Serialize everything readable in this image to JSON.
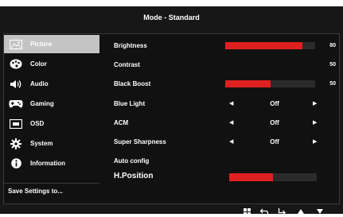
{
  "header": {
    "title": "Mode - Standard"
  },
  "sidebar": {
    "items": [
      {
        "label": "Picture",
        "icon": "picture-icon",
        "active": true
      },
      {
        "label": "Color",
        "icon": "palette-icon",
        "active": false
      },
      {
        "label": "Audio",
        "icon": "speaker-icon",
        "active": false
      },
      {
        "label": "Gaming",
        "icon": "gamepad-icon",
        "active": false
      },
      {
        "label": "OSD",
        "icon": "osd-icon",
        "active": false
      },
      {
        "label": "System",
        "icon": "gear-icon",
        "active": false
      },
      {
        "label": "Information",
        "icon": "info-icon",
        "active": false
      }
    ],
    "save_label": "Save Settings to..."
  },
  "settings": {
    "brightness": {
      "label": "Brightness",
      "value": "80",
      "fraction": 0.86
    },
    "contrast": {
      "label": "Contrast",
      "value": "50"
    },
    "black_boost": {
      "label": "Black Boost",
      "value": "50",
      "fraction": 0.5
    },
    "blue_light": {
      "label": "Blue Light",
      "value": "Off"
    },
    "acm": {
      "label": "ACM",
      "value": "Off"
    },
    "super_sharpness": {
      "label": "Super Sharpness",
      "value": "Off"
    },
    "auto_config": {
      "label": "Auto config"
    },
    "h_position": {
      "label": "H.Position",
      "fraction": 0.5
    }
  },
  "footer": {
    "icons": [
      "grid-icon",
      "back-icon",
      "enter-icon",
      "up-icon",
      "down-icon"
    ]
  },
  "colors": {
    "accent": "#e02020",
    "background": "#171717",
    "active_item": "#c4c4c4"
  }
}
